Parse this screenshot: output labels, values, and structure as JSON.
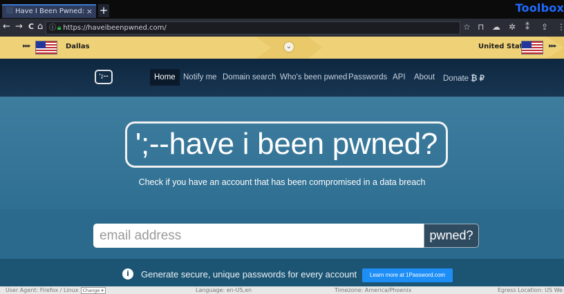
{
  "browser": {
    "tab": {
      "title": "Have I Been Pwned: Che",
      "close": "×"
    },
    "new_tab": "+",
    "brand": "Toolbox",
    "nav": {
      "back": "←",
      "forward": "→",
      "reload": "C",
      "home": "⌂"
    },
    "url": "https://haveibeenpwned.com/",
    "toolbar_icons": [
      "star-icon",
      "bookmark-icon",
      "cloud-icon",
      "bug-icon",
      "extension-icon",
      "share-icon",
      "menu-icon"
    ]
  },
  "location_banner": {
    "city": "Dallas",
    "country": "United States",
    "toggle_icon": "chevron-down-icon",
    "color": "#e9c96a"
  },
  "site": {
    "logo": "';--",
    "menu": [
      {
        "label": "Home",
        "active": true
      },
      {
        "label": "Notify me"
      },
      {
        "label": "Domain search"
      },
      {
        "label": "Who's been pwned"
      },
      {
        "label": "Passwords"
      },
      {
        "label": "API"
      },
      {
        "label": "About"
      },
      {
        "label": "Donate"
      }
    ],
    "donate_icons": "₿ ₽"
  },
  "hero": {
    "title": "';--have i been pwned?",
    "subtitle": "Check if you have an account that has been compromised in a data breach"
  },
  "search": {
    "placeholder": "email address",
    "button": "pwned?"
  },
  "promo": {
    "icon": "1password-icon",
    "text": "Generate secure, unique passwords for every account",
    "button": "Learn more at 1Password.com"
  },
  "status_bar": {
    "user_agent_label": "User Agent:",
    "user_agent_value": "Firefox / Linux",
    "user_agent_select": "Change",
    "language_label": "Language:",
    "language_value": "en-US,en",
    "timezone_label": "Timezone:",
    "timezone_value": "America/Phoenix",
    "egress_label": "Egress Location:",
    "egress_value": "US We"
  }
}
